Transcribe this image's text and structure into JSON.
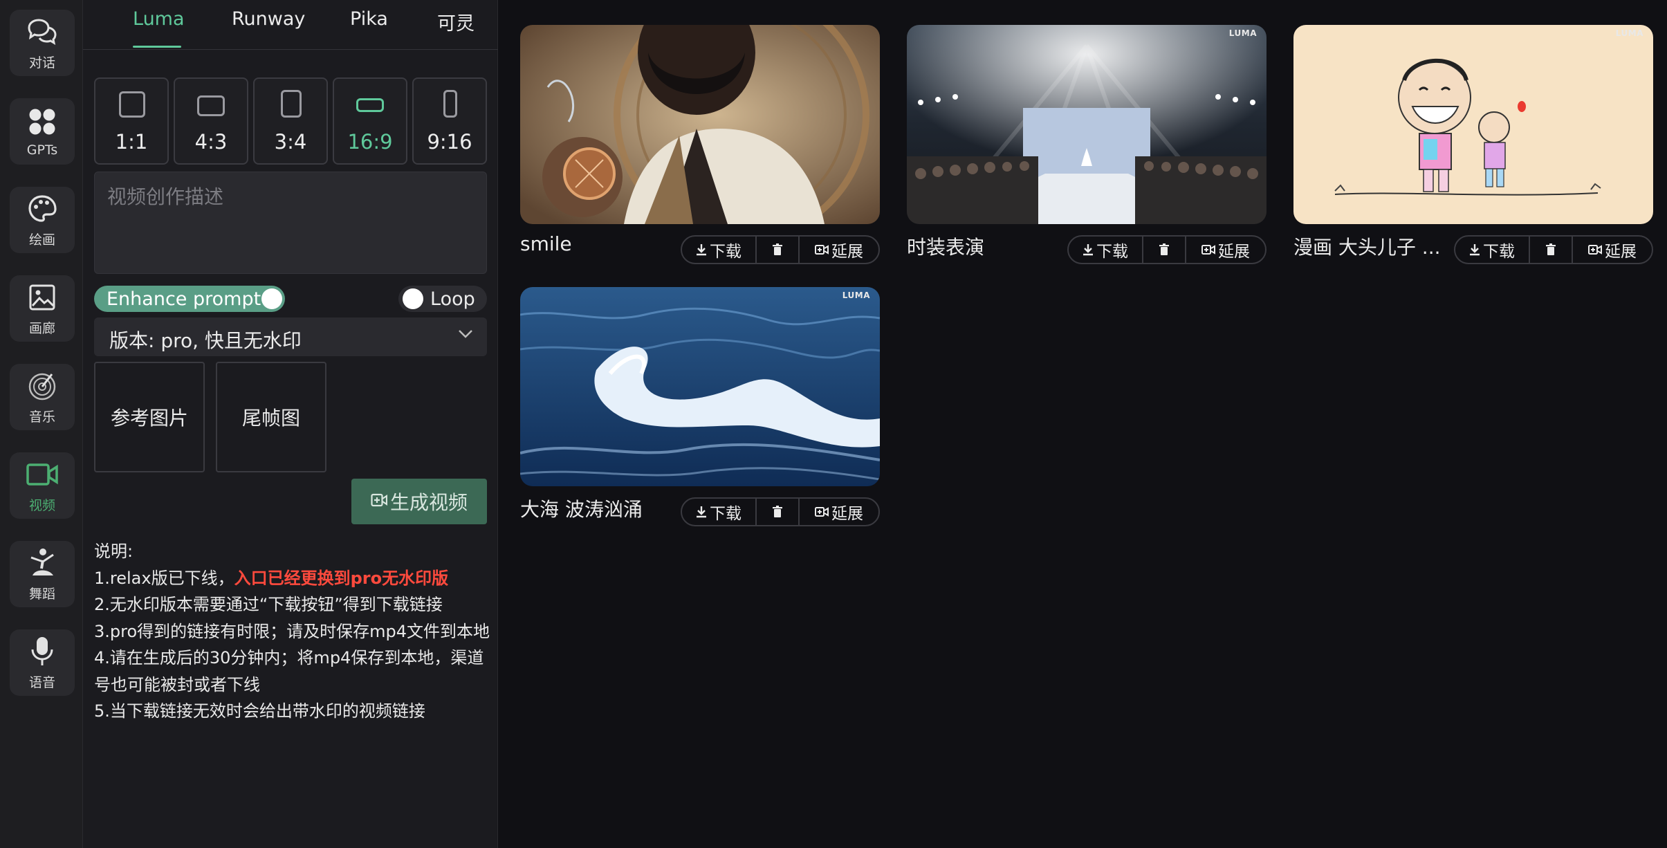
{
  "sidebar": {
    "items": [
      {
        "label": "对话",
        "icon": "chat-bubbles-icon"
      },
      {
        "label": "GPTs",
        "icon": "apps-grid-icon"
      },
      {
        "label": "绘画",
        "icon": "palette-icon"
      },
      {
        "label": "画廊",
        "icon": "image-icon"
      },
      {
        "label": "音乐",
        "icon": "music-disc-icon"
      },
      {
        "label": "视频",
        "icon": "video-camera-icon",
        "active": true
      },
      {
        "label": "舞蹈",
        "icon": "dancer-icon"
      },
      {
        "label": "语音",
        "icon": "microphone-icon"
      }
    ]
  },
  "tabs": [
    "Luma",
    "Runway",
    "Pika",
    "可灵"
  ],
  "active_tab": "Luma",
  "ratios": [
    {
      "label": "1:1"
    },
    {
      "label": "4:3"
    },
    {
      "label": "3:4"
    },
    {
      "label": "16:9",
      "active": true
    },
    {
      "label": "9:16"
    }
  ],
  "prompt": {
    "placeholder": "视频创作描述",
    "value": ""
  },
  "enhance_prompt": {
    "label": "Enhance prompt",
    "on": true
  },
  "loop": {
    "label": "Loop",
    "on": false
  },
  "version": {
    "label": "版本: pro, 快且无水印"
  },
  "uploads": {
    "reference": "参考图片",
    "end_frame": "尾帧图"
  },
  "generate_button": "生成视频",
  "notes": {
    "heading": "说明:",
    "line1_prefix": "1.relax版已下线，",
    "line1_highlight": "入口已经更换到pro无水印版",
    "line2": "2.无水印版本需要通过“下载按钮”得到下载链接",
    "line3": "3.pro得到的链接有时限；请及时保存mp4文件到本地",
    "line4": "4.请在生成后的30分钟内；将mp4保存到本地，渠道号也可能被封或者下线",
    "line5": "5.当下载链接无效时会给出带水印的视频链接"
  },
  "card_actions": {
    "download": "下载",
    "extend": "延展"
  },
  "videos": [
    {
      "title": "smile",
      "watermark": ""
    },
    {
      "title": "时装表演",
      "watermark": "LUMA"
    },
    {
      "title": "漫画 大头儿子 ...",
      "watermark": "LUMA"
    },
    {
      "title": "大海 波涛汹涌",
      "watermark": "LUMA"
    }
  ],
  "colors": {
    "accent": "#5fc99b",
    "toggle_on": "#5a9e86",
    "generate_bg": "#3c6955",
    "warning": "#ff4a3d",
    "panel_bg": "#1b1b1f",
    "page_bg": "#101014"
  }
}
